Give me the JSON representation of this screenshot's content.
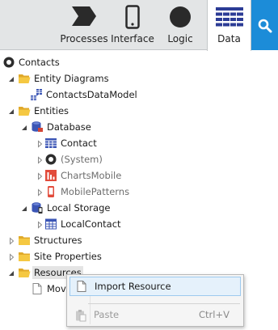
{
  "toolbar": {
    "tabs": [
      {
        "label": "Processes",
        "icon": "processes-icon"
      },
      {
        "label": "Interface",
        "icon": "mobile-device-icon"
      },
      {
        "label": "Logic",
        "icon": "logic-circle-icon"
      },
      {
        "label": "Data",
        "icon": "data-grid-icon",
        "active": true
      }
    ],
    "search_icon": "search-icon"
  },
  "tree": {
    "root": "Contacts",
    "entity_diagrams": "Entity Diagrams",
    "contacts_data_model": "ContactsDataModel",
    "entities": "Entities",
    "database": "Database",
    "contact": "Contact",
    "system": "(System)",
    "charts_mobile": "ChartsMobile",
    "mobile_patterns": "MobilePatterns",
    "local_storage": "Local Storage",
    "local_contact": "LocalContact",
    "structures": "Structures",
    "site_properties": "Site Properties",
    "resources": "Resources",
    "resource_child": "Mov"
  },
  "context_menu": {
    "import_resource": "Import Resource",
    "paste": "Paste",
    "paste_shortcut": "Ctrl+V"
  },
  "colors": {
    "accent_blue": "#1c8cd8",
    "data_tab_icon": "#2c3c96",
    "folder_yellow": "#f2c94c",
    "charts_red": "#e24b3b"
  }
}
